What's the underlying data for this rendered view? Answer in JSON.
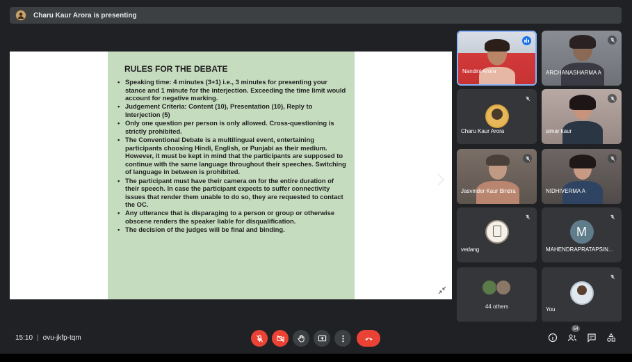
{
  "presenting_banner": "Charu Kaur Arora is presenting",
  "slide": {
    "title": "RULES FOR THE DEBATE",
    "rules": [
      "Speaking time: 4 minutes (3+1) i.e., 3 minutes for presenting your stance and 1 minute for the interjection. Exceeding the time limit would account for negative marking.",
      "Judgement Criteria:  Content (10), Presentation (10), Reply to Interjection (5)",
      " Only one question per person is only allowed. Cross-questioning is strictly prohibited.",
      "The Conventional Debate is a multilingual event, entertaining participants choosing Hindi, English, or Punjabi as their medium. However, it must be kept in mind that the participants are supposed to continue with the same language throughout their speeches. Switching of language in between is prohibited.",
      "The participant must have their camera on for the entire duration of their speech. In case the participant expects to suffer connectivity issues that render them unable to do so, they are requested to contact the OC.",
      "Any utterance that is disparaging to a person or group or otherwise obscene renders the speaker liable for disqualification.",
      "The decision of the judges will be final and binding."
    ]
  },
  "participants": [
    {
      "name": "Nandini Arora"
    },
    {
      "name": "ARCHANASHARMA A"
    },
    {
      "name": "Charu Kaur Arora"
    },
    {
      "name": "simar kaur"
    },
    {
      "name": "Jasvinder Kaur Bindra"
    },
    {
      "name": "NIDHIVERMA A"
    },
    {
      "name": "vedang"
    },
    {
      "name": "MAHENDRAPRATAPSIN...",
      "initial": "M"
    },
    {
      "name": "44 others"
    },
    {
      "name": "You"
    }
  ],
  "bottom": {
    "time": "15:10",
    "meeting_code": "ovu-jkfp-tqm",
    "people_count": "54"
  },
  "colors": {
    "end_call": "#ea4335",
    "speaking": "#1a73e8",
    "slide_bg": "#c6dcbf"
  }
}
